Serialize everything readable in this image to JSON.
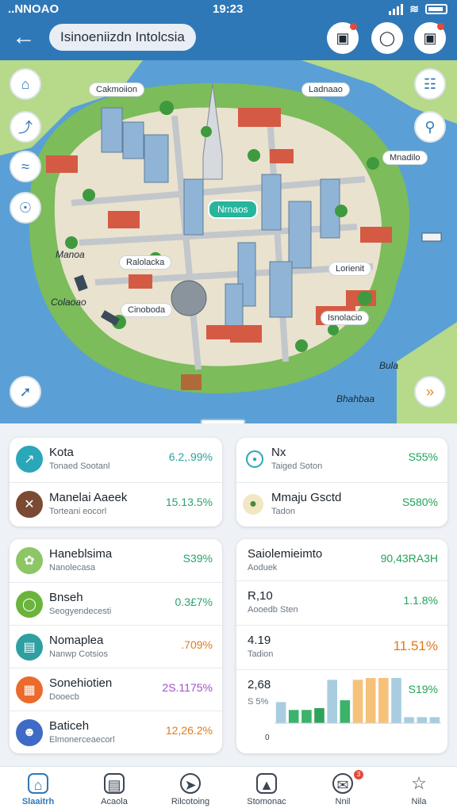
{
  "status": {
    "carrier": "..NNOAO",
    "time": "19:23"
  },
  "header": {
    "title": "Isinoeniizdn Intolcsia"
  },
  "map": {
    "labels": [
      "Cakmoiion",
      "Ladnaao",
      "Mnadilo",
      "Ralolacka",
      "Lorienit",
      "Isnolacio",
      "Cinoboda"
    ],
    "pin_label": "Nrnaos",
    "sea_labels": [
      "Manoa",
      "Colaoao",
      "Bula",
      "Bhahbaa"
    ]
  },
  "cards": {
    "top_left": [
      {
        "title": "Kota",
        "sub": "Tonaed Sootanl",
        "value": "6.2,.99%",
        "icon": "chart-icon",
        "color": "#2aa7b8",
        "value_color": "#27a3a0"
      },
      {
        "title": "Manelai Aaeek",
        "sub": "Torteani eocorl",
        "value": "15.13.5%",
        "icon": "tools-icon",
        "color": "#7a4a32",
        "value_color": "#2aa36b"
      }
    ],
    "top_right": [
      {
        "title": "Nx",
        "sub": "Taiged Soton",
        "value": "S55%",
        "icon": "target-icon",
        "color": "#ffffff",
        "value_color": "#22a35a"
      },
      {
        "title": "Mmaju Gsctd",
        "sub": "Tadon",
        "value": "S580%",
        "icon": "globe-icon",
        "color": "#f1e7c2",
        "value_color": "#22a35a"
      }
    ],
    "bottom_left": [
      {
        "title": "Haneblsima",
        "sub": "Nanolecasa",
        "value": "S39%",
        "icon": "leaf-icon",
        "color": "#8cc665",
        "value_color": "#2aa36b"
      },
      {
        "title": "Bnseh",
        "sub": "Seogyendecesti",
        "value": "0.3£7%",
        "icon": "bulb-icon",
        "color": "#6ab43b",
        "value_color": "#2aa36b"
      },
      {
        "title": "Nomaplea",
        "sub": "Nanwp Cotsios",
        "value": ".709%",
        "icon": "store-icon",
        "color": "#2f9fa2",
        "value_color": "#e27a1a"
      },
      {
        "title": "Sonehiotien",
        "sub": "Dooecb",
        "value": "2S.1175%",
        "icon": "grid-icon",
        "color": "#ec6a2c",
        "value_color": "#a24fc7"
      },
      {
        "title": "Baticeh",
        "sub": "Elmonerceaecorl",
        "value": "12,26.2%",
        "icon": "person-icon",
        "color": "#3f6ac6",
        "value_color": "#e27a1a"
      }
    ],
    "bottom_right": [
      {
        "title": "Saiolemieimto",
        "sub": "Aoduek",
        "value": "90,43RA3H",
        "value_color": "#22a35a"
      },
      {
        "title": "R,10",
        "sub": "Aooedb Sten",
        "value": "1.1.8%",
        "value_color": "#22a35a"
      },
      {
        "title": "4.19",
        "sub": "Tadion",
        "value": "11.51%",
        "value_color": "#e27a1a"
      },
      {
        "title": "2,68",
        "sub": "S 5%",
        "value": "S19%",
        "value_color": "#22a35a"
      }
    ]
  },
  "chart_data": {
    "type": "bar",
    "ylabel": "0",
    "series": [
      {
        "values": [
          0.35,
          0.22,
          0.22,
          0.25,
          0.72,
          0.38,
          0.72,
          0.75,
          0.75,
          0.75,
          0.1,
          0.1,
          0.1
        ]
      }
    ],
    "colors": [
      "#a8cde0",
      "#3bb36b",
      "#3bb36b",
      "#2fa35c",
      "#a8cde0",
      "#3bb36b",
      "#f6c27a",
      "#f6c27a",
      "#f6c27a",
      "#a8cde0",
      "#a8cde0",
      "#a8cde0",
      "#a8cde0"
    ]
  },
  "nav": [
    {
      "label": "Slaaitrh",
      "icon": "home-icon",
      "active": true
    },
    {
      "label": "Acaola",
      "icon": "clipboard-icon"
    },
    {
      "label": "Rilcotoing",
      "icon": "compass-icon"
    },
    {
      "label": "Stomonac",
      "icon": "image-icon"
    },
    {
      "label": "Nnil",
      "icon": "chat-icon",
      "badge": "3"
    },
    {
      "label": "Nila",
      "icon": "star-icon"
    }
  ]
}
